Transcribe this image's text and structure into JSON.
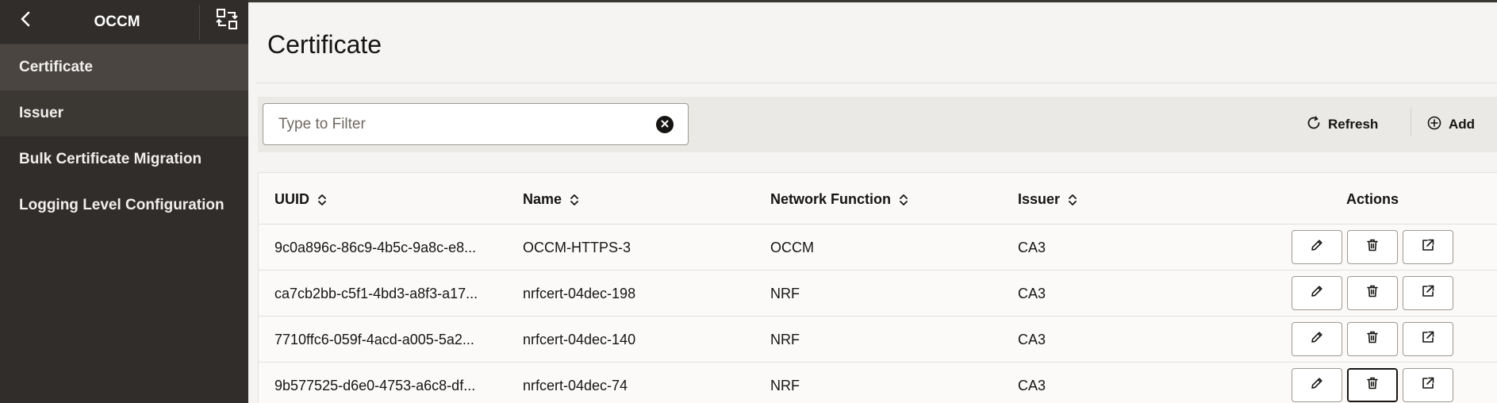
{
  "sidebar": {
    "title": "OCCM",
    "items": [
      {
        "label": "Certificate"
      },
      {
        "label": "Issuer"
      },
      {
        "label": "Bulk Certificate Migration"
      },
      {
        "label": "Logging Level Configuration"
      }
    ]
  },
  "main": {
    "title": "Certificate",
    "filter": {
      "placeholder": "Type to Filter",
      "value": ""
    },
    "toolbar": {
      "refresh_label": "Refresh",
      "add_label": "Add"
    }
  },
  "table": {
    "columns": [
      "UUID",
      "Name",
      "Network Function",
      "Issuer",
      "Actions"
    ],
    "rows": [
      {
        "uuid": "9c0a896c-86c9-4b5c-9a8c-e8...",
        "name": "OCCM-HTTPS-3",
        "nf": "OCCM",
        "issuer": "CA3"
      },
      {
        "uuid": "ca7cb2bb-c5f1-4bd3-a8f3-a17...",
        "name": "nrfcert-04dec-198",
        "nf": "NRF",
        "issuer": "CA3"
      },
      {
        "uuid": "7710ffc6-059f-4acd-a005-5a2...",
        "name": "nrfcert-04dec-140",
        "nf": "NRF",
        "issuer": "CA3"
      },
      {
        "uuid": "9b577525-d6e0-4753-a6c8-df...",
        "name": "nrfcert-04dec-74",
        "nf": "NRF",
        "issuer": "CA3"
      }
    ]
  },
  "icons": {
    "back": "chevron-left-icon",
    "switch": "app-switcher-icon",
    "clear": "clear-circle-icon",
    "refresh": "refresh-icon",
    "add": "add-circle-icon",
    "sort": "sort-icon",
    "edit": "pencil-icon",
    "delete": "trash-icon",
    "open": "open-external-icon"
  },
  "colors": {
    "sidebar_bg": "#312d2a",
    "sidebar_selected": "#4a4541",
    "page_bg": "#f5f4f2",
    "toolbar_bg": "#ebe9e6"
  }
}
